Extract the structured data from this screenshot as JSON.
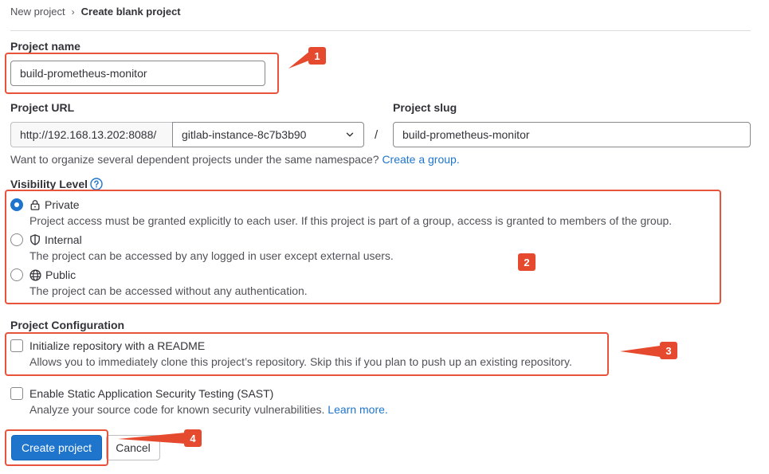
{
  "breadcrumb": {
    "parent": "New project",
    "current": "Create blank project"
  },
  "project_name": {
    "label": "Project name",
    "value": "build-prometheus-monitor"
  },
  "project_url": {
    "label": "Project URL",
    "prefix": "http://192.168.13.202:8088/",
    "namespace": "gitlab-instance-8c7b3b90",
    "separator": "/"
  },
  "project_slug": {
    "label": "Project slug",
    "value": "build-prometheus-monitor"
  },
  "namespace_help": {
    "text": "Want to organize several dependent projects under the same namespace?",
    "link": "Create a group."
  },
  "visibility": {
    "label": "Visibility Level",
    "options": [
      {
        "title": "Private",
        "desc": "Project access must be granted explicitly to each user. If this project is part of a group, access is granted to members of the group.",
        "icon": "lock-icon",
        "checked": true
      },
      {
        "title": "Internal",
        "desc": "The project can be accessed by any logged in user except external users.",
        "icon": "shield-icon",
        "checked": false
      },
      {
        "title": "Public",
        "desc": "The project can be accessed without any authentication.",
        "icon": "globe-icon",
        "checked": false
      }
    ]
  },
  "config": {
    "label": "Project Configuration",
    "readme": {
      "title": "Initialize repository with a README",
      "desc": "Allows you to immediately clone this project’s repository. Skip this if you plan to push up an existing repository.",
      "checked": false
    },
    "sast": {
      "title": "Enable Static Application Security Testing (SAST)",
      "desc": "Analyze your source code for known security vulnerabilities.",
      "link": "Learn more.",
      "checked": false
    }
  },
  "actions": {
    "create": "Create project",
    "cancel": "Cancel"
  },
  "annotations": {
    "one": "1",
    "two": "2",
    "three": "3",
    "four": "4"
  },
  "colors": {
    "primary": "#1f75cb",
    "annotation": "#e8533b",
    "text": "#333238"
  }
}
